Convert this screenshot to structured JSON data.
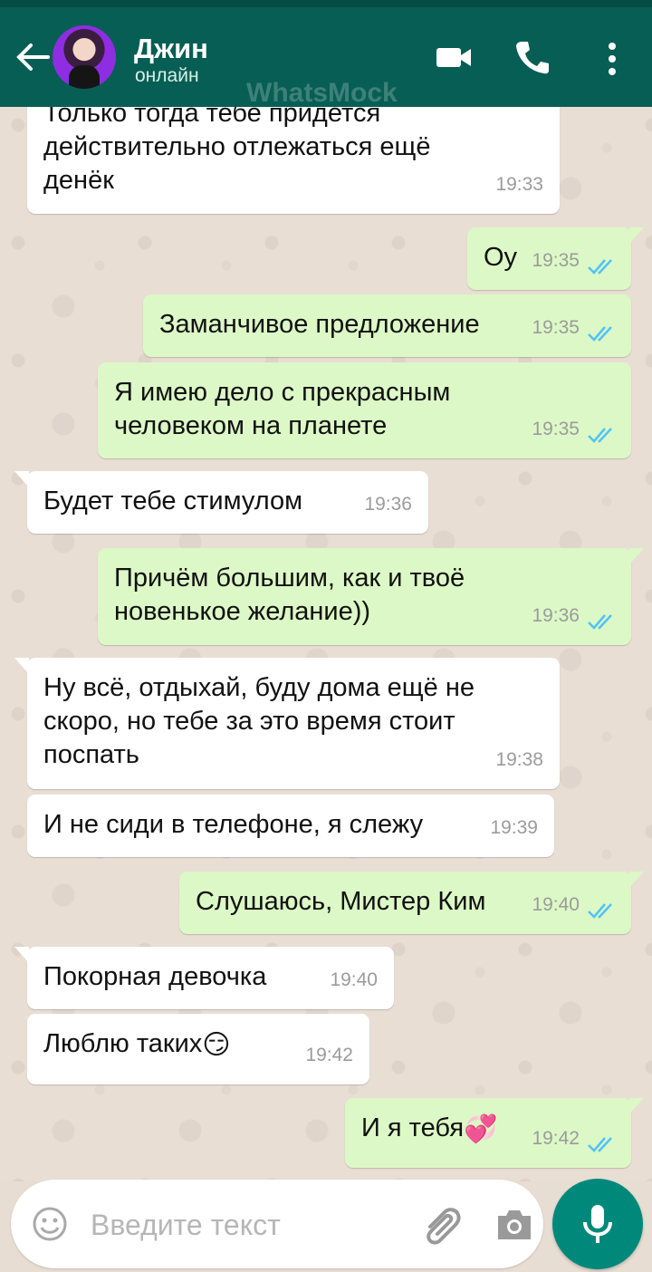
{
  "header": {
    "contact_name": "Джин",
    "status": "онлайн",
    "watermark": "WhatsMock"
  },
  "messages": [
    {
      "from": "contact",
      "text": "Только тогда тебе придется\nдействительно отлежаться ещё\nденёк",
      "time": "19:33"
    },
    {
      "from": "me",
      "text": "Оу",
      "time": "19:35",
      "status": "read"
    },
    {
      "from": "me",
      "text": "Заманчивое предложение",
      "time": "19:35",
      "status": "read"
    },
    {
      "from": "me",
      "text": "Я имею дело с прекрасным\nчеловеком на планете",
      "time": "19:35",
      "status": "read"
    },
    {
      "from": "contact",
      "text": "Будет тебе стимулом",
      "time": "19:36"
    },
    {
      "from": "me",
      "text": "Причём большим, как и твоё\nновенькое желание))",
      "time": "19:36",
      "status": "read"
    },
    {
      "from": "contact",
      "text": "Ну всё, отдыхай, буду дома ещё не\nскоро, но тебе за это время стоит\nпоспать",
      "time": "19:38"
    },
    {
      "from": "contact",
      "text": "И не сиди в телефоне, я слежу",
      "time": "19:39"
    },
    {
      "from": "me",
      "text": "Слушаюсь, Мистер Ким",
      "time": "19:40",
      "status": "read"
    },
    {
      "from": "contact",
      "text": "Покорная девочка",
      "time": "19:40"
    },
    {
      "from": "contact",
      "text": "Люблю таких",
      "emoji": "😏",
      "time": "19:42"
    },
    {
      "from": "me",
      "text": "И я тебя",
      "emoji": "💞",
      "time": "19:42",
      "status": "read"
    }
  ],
  "composer": {
    "placeholder": "Введите текст"
  },
  "colors": {
    "header": "#075e54",
    "incoming_bubble": "#ffffff",
    "outgoing_bubble": "#dcf8c6",
    "read_ticks": "#4fc3f7",
    "mic_button": "#00897b"
  }
}
